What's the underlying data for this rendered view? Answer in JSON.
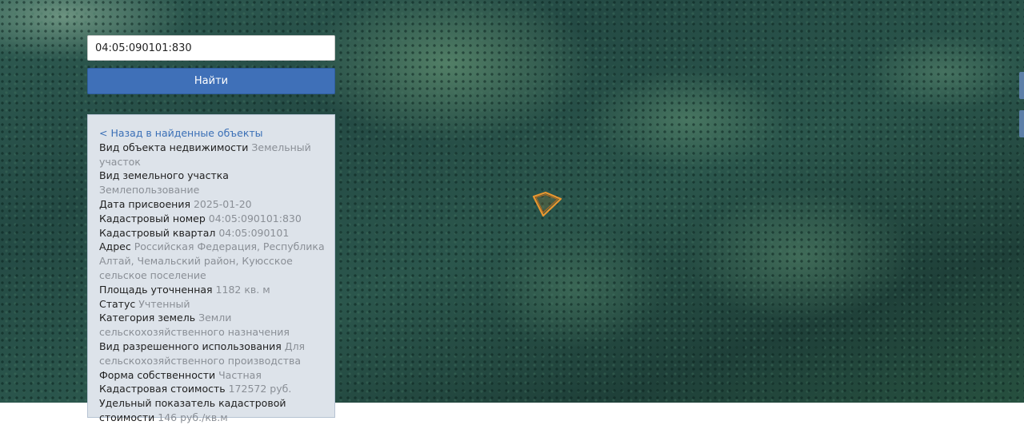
{
  "search": {
    "value": "04:05:090101:830",
    "button_label": "Найти"
  },
  "info": {
    "back_link": "< Назад в найденные объекты",
    "rows": [
      {
        "label": "Вид объекта недвижимости",
        "value": "Земельный участок"
      },
      {
        "label": "Вид земельного участка",
        "value": "Землепользование"
      },
      {
        "label": "Дата присвоения",
        "value": "2025-01-20"
      },
      {
        "label": "Кадастровый номер",
        "value": "04:05:090101:830"
      },
      {
        "label": "Кадастровый квартал",
        "value": "04:05:090101"
      },
      {
        "label": "Адрес",
        "value": "Российская Федерация, Республика Алтай, Чемальский район, Куюсское сельское поселение"
      },
      {
        "label": "Площадь уточненная",
        "value": "1182 кв. м"
      },
      {
        "label": "Статус",
        "value": "Учтенный"
      },
      {
        "label": "Категория земель",
        "value": "Земли сельскохозяйственного назначения"
      },
      {
        "label": "Вид разрешенного использования",
        "value": "Для сельскохозяйственного производства"
      },
      {
        "label": "Форма собственности",
        "value": "Частная"
      },
      {
        "label": "Кадастровая стоимость",
        "value": "172572 руб."
      },
      {
        "label": "Удельный показатель кадастровой стоимости",
        "value": "146 руб./кв.м"
      }
    ]
  },
  "map": {
    "layer": "satellite",
    "parcel_outline_color": "#e8962f"
  }
}
